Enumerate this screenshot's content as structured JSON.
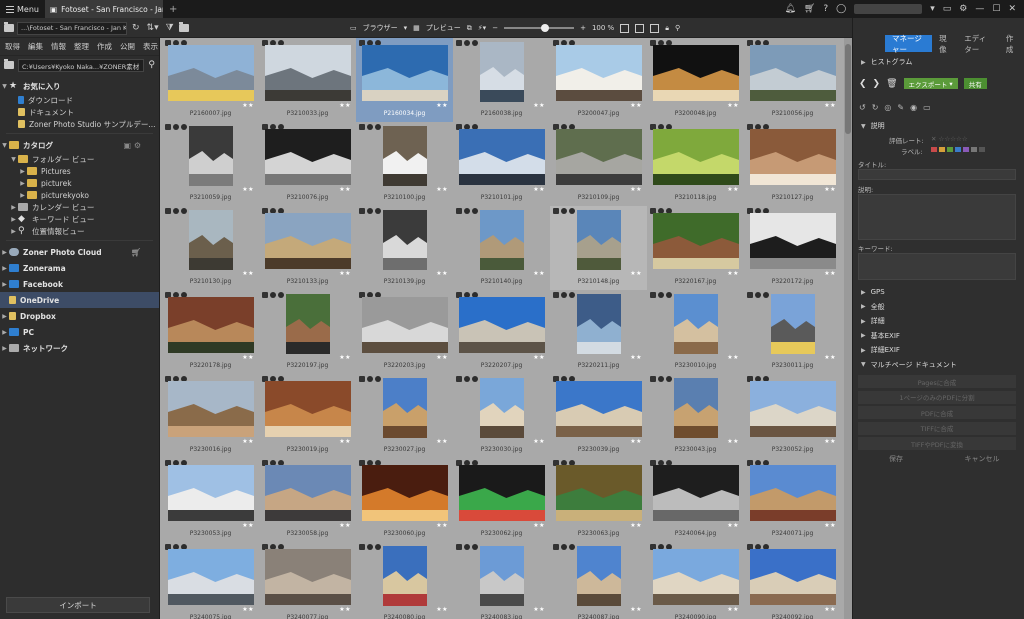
{
  "titlebar": {
    "menu_label": "Menu",
    "tab_title": "Fotoset - San Francisco - Jan ...",
    "tab_close": "×",
    "new_tab": "+"
  },
  "toolbar": {
    "path_value": "...\\Fotoset - San Francisco - Jan Kupc",
    "browser_label": "ブラウザー",
    "preview_label": "プレビュー",
    "zoom_level": "100 %",
    "zoom_fraction": 0.6
  },
  "left": {
    "menu_items": [
      "取得",
      "編集",
      "情報",
      "整理",
      "作成",
      "公開",
      "表示"
    ],
    "path_value": "C:¥Users¥Kyoko Naka...¥ZONER素材",
    "favorites": {
      "label": "お気に入り",
      "items": [
        "ダウンロード",
        "ドキュメント",
        "Zoner Photo Studio サンプルデー..."
      ]
    },
    "catalog": {
      "label": "カタログ",
      "folder_view": "フォルダー ビュー",
      "folders": [
        "Pictures",
        "picturek",
        "picturekyoko"
      ],
      "calendar_view": "カレンダー ビュー",
      "keyword_view": "キーワード ビュー",
      "location_view": "位置情報ビュー"
    },
    "services": [
      "Zoner Photo Cloud",
      "Zonerama",
      "Facebook",
      "OneDrive",
      "Dropbox",
      "PC",
      "ネットワーク"
    ],
    "import_label": "インポート"
  },
  "grid": {
    "rating_text": "★★",
    "selected_index": 2,
    "hover_index": 18,
    "items": [
      {
        "name": "P2160007.jpg",
        "colors": [
          "#8fb2d6",
          "#7c8a9a",
          "#e7c85a"
        ]
      },
      {
        "name": "P3210033.jpg",
        "colors": [
          "#cfd7df",
          "#6d757d",
          "#3c3a36"
        ]
      },
      {
        "name": "P2160034.jpg",
        "colors": [
          "#2d6bb0",
          "#8cb7da",
          "#d9d2c2"
        ]
      },
      {
        "name": "P2160038.jpg",
        "colors": [
          "#aab7c5",
          "#d6dde5",
          "#3a4a5a"
        ]
      },
      {
        "name": "P3200047.jpg",
        "colors": [
          "#a9cbe7",
          "#f1efe9",
          "#5b4c3f"
        ]
      },
      {
        "name": "P3200048.jpg",
        "colors": [
          "#111111",
          "#c48b42",
          "#e9d7b4"
        ]
      },
      {
        "name": "P3210056.jpg",
        "colors": [
          "#7d9bb8",
          "#c3ccd3",
          "#4e5c3d"
        ]
      },
      {
        "name": "P3210059.jpg",
        "colors": [
          "#3a3a3a",
          "#cfcfcf",
          "#7b7b7b"
        ]
      },
      {
        "name": "P3210076.jpg",
        "colors": [
          "#1e1e1e",
          "#d4d4d4",
          "#777777"
        ]
      },
      {
        "name": "P3210100.jpg",
        "colors": [
          "#6e6252",
          "#f1f1f1",
          "#3f3a33"
        ]
      },
      {
        "name": "P3210101.jpg",
        "colors": [
          "#3a6fb5",
          "#d3dde9",
          "#2a3340"
        ]
      },
      {
        "name": "P3210109.jpg",
        "colors": [
          "#5f6e4e",
          "#a6a6a1",
          "#3c3c3c"
        ]
      },
      {
        "name": "P3210118.jpg",
        "colors": [
          "#7fa93c",
          "#c4d86a",
          "#2f4a1a"
        ]
      },
      {
        "name": "P3210127.jpg",
        "colors": [
          "#8a5a3a",
          "#c69a75",
          "#f1e6d6"
        ]
      },
      {
        "name": "P3210130.jpg",
        "colors": [
          "#a9b7c0",
          "#6b5f4c",
          "#3d3a33"
        ]
      },
      {
        "name": "P3210133.jpg",
        "colors": [
          "#8aa4c1",
          "#c4a97a",
          "#4c3b2a"
        ]
      },
      {
        "name": "P3210139.jpg",
        "colors": [
          "#3b3b3b",
          "#d9d9d9",
          "#6e6e6e"
        ]
      },
      {
        "name": "P3210140.jpg",
        "colors": [
          "#6d98c8",
          "#b09a79",
          "#4a5a3a"
        ]
      },
      {
        "name": "P3210148.jpg",
        "colors": [
          "#5a86b9",
          "#a7a08d",
          "#4f5a3b"
        ]
      },
      {
        "name": "P3220167.jpg",
        "colors": [
          "#3f6b2a",
          "#8c5a3a",
          "#d6c9a0"
        ]
      },
      {
        "name": "P3220172.jpg",
        "colors": [
          "#e6e6e6",
          "#1d1d1d",
          "#8a8a8a"
        ]
      },
      {
        "name": "P3220178.jpg",
        "colors": [
          "#7a3f2a",
          "#b8885a",
          "#2f3a25"
        ]
      },
      {
        "name": "P3220197.jpg",
        "colors": [
          "#4a6f3a",
          "#9a6b4a",
          "#2a2a2a"
        ]
      },
      {
        "name": "P3220203.jpg",
        "colors": [
          "#9a9a9a",
          "#d8d8d8",
          "#5c4e3f"
        ]
      },
      {
        "name": "P3220207.jpg",
        "colors": [
          "#2a6fc9",
          "#c9c3b6",
          "#5c5348"
        ]
      },
      {
        "name": "P3220211.jpg",
        "colors": [
          "#3d5c88",
          "#8fb0d0",
          "#d3dbe2"
        ]
      },
      {
        "name": "P3230010.jpg",
        "colors": [
          "#5b8fd0",
          "#d4c0a0",
          "#8a6a4a"
        ]
      },
      {
        "name": "P3230011.jpg",
        "colors": [
          "#7aa3d8",
          "#5a5a5a",
          "#e7c95a"
        ]
      },
      {
        "name": "P3230016.jpg",
        "colors": [
          "#a7b7c8",
          "#8a6b4a",
          "#c9a27a"
        ]
      },
      {
        "name": "P3230019.jpg",
        "colors": [
          "#8a4a2a",
          "#c7864a",
          "#e6d1b0"
        ]
      },
      {
        "name": "P3230027.jpg",
        "colors": [
          "#4c7fc8",
          "#c9a06a",
          "#6b4a2f"
        ]
      },
      {
        "name": "P3230030.jpg",
        "colors": [
          "#7aa7d9",
          "#e1d4bd",
          "#5a4a3a"
        ]
      },
      {
        "name": "P3230039.jpg",
        "colors": [
          "#3b77c9",
          "#d8cbb3",
          "#7a6148"
        ]
      },
      {
        "name": "P3230043.jpg",
        "colors": [
          "#5a7fb0",
          "#c7a271",
          "#6f4d2e"
        ]
      },
      {
        "name": "P3230052.jpg",
        "colors": [
          "#8bb0dd",
          "#dcd6c8",
          "#6a5542"
        ]
      },
      {
        "name": "P3230053.jpg",
        "colors": [
          "#9fc0e4",
          "#ececec",
          "#3b3b3b"
        ]
      },
      {
        "name": "P3230058.jpg",
        "colors": [
          "#6b89b5",
          "#c6a684",
          "#3d3a3a"
        ]
      },
      {
        "name": "P3230060.jpg",
        "colors": [
          "#4a1d0f",
          "#d47a2a",
          "#f1c47a"
        ]
      },
      {
        "name": "P3230062.jpg",
        "colors": [
          "#1a1a1a",
          "#3aa84a",
          "#d94a3a"
        ]
      },
      {
        "name": "P3230063.jpg",
        "colors": [
          "#6a5a2a",
          "#3d7d3d",
          "#c9b07a"
        ]
      },
      {
        "name": "P3240064.jpg",
        "colors": [
          "#1e1e1e",
          "#bcbcbc",
          "#686868"
        ]
      },
      {
        "name": "P3240071.jpg",
        "colors": [
          "#5a8bd1",
          "#c29a6a",
          "#7a3d2a"
        ]
      },
      {
        "name": "P3240075.jpg",
        "colors": [
          "#7eaee0",
          "#d9dde3",
          "#505860"
        ]
      },
      {
        "name": "P3240077.jpg",
        "colors": [
          "#8a8178",
          "#c2b4a3",
          "#5a4f46"
        ]
      },
      {
        "name": "P3240080.jpg",
        "colors": [
          "#3a6fbd",
          "#d8c7a0",
          "#b03a3a"
        ]
      },
      {
        "name": "P3240083.jpg",
        "colors": [
          "#6c9bd6",
          "#c8c8c8",
          "#4a4a4a"
        ]
      },
      {
        "name": "P3240087.jpg",
        "colors": [
          "#4f84cf",
          "#cdb89a",
          "#5a4a3a"
        ]
      },
      {
        "name": "P3240090.jpg",
        "colors": [
          "#7aa9de",
          "#e0d6c3",
          "#6a5a48"
        ]
      },
      {
        "name": "P3240092.jpg",
        "colors": [
          "#3a70c8",
          "#d9cdb7",
          "#8a6a50"
        ]
      }
    ]
  },
  "right": {
    "tabs": [
      "マネージャー",
      "現像",
      "エディター",
      "作成"
    ],
    "histogram": "ヒストグラム",
    "export_label": "エクスポート",
    "share_label": "共有",
    "description": "説明",
    "rating_label": "評価レート:",
    "label_label": "ラベル:",
    "title_label": "タイトル:",
    "desc_label": "説明:",
    "keyword_label": "キーワード:",
    "sections": [
      "GPS",
      "全般",
      "詳細",
      "基本EXIF",
      "詳細EXIF",
      "マルチページ ドキュメント"
    ],
    "disabled_buttons": [
      "Pagesに合成",
      "1ページのみのPDFに分割",
      "PDFに合成",
      "TIFFに合成",
      "TIFFやPDFに変換"
    ],
    "save_label": "保存",
    "cancel_label": "キャンセル",
    "label_colors": [
      "#c84a4a",
      "#d6a03a",
      "#5b9b3a",
      "#3a7bc9",
      "#8a5ab8",
      "#777777",
      "#555555"
    ]
  }
}
